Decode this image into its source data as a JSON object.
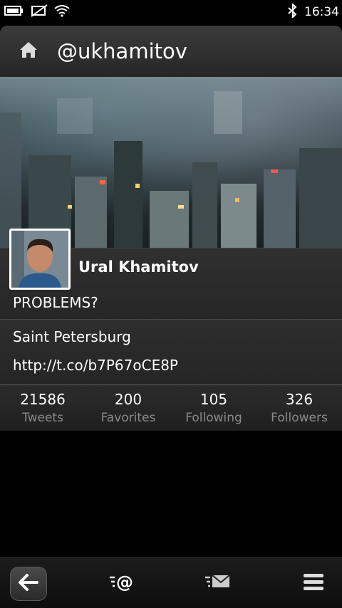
{
  "status_bar": {
    "time": "16:34",
    "icons": [
      "battery-icon",
      "no-sim-icon",
      "wifi-icon",
      "bluetooth-icon"
    ]
  },
  "header": {
    "title": "@ukhamitov",
    "home_icon": "home-icon"
  },
  "profile": {
    "display_name": "Ural Khamitov",
    "bio": "PROBLEMS?",
    "location": "Saint Petersburg",
    "url": "http://t.co/b7P67oCE8P"
  },
  "stats": [
    {
      "value": "21586",
      "label": "Tweets"
    },
    {
      "value": "200",
      "label": "Favorites"
    },
    {
      "value": "105",
      "label": "Following"
    },
    {
      "value": "326",
      "label": "Followers"
    }
  ],
  "toolbar": {
    "back_icon": "back-arrow-icon",
    "mentions_icon": "mentions-icon",
    "messages_icon": "direct-messages-icon",
    "menu_icon": "menu-icon"
  },
  "colors": {
    "background": "#000000",
    "header": "#2f2f2f",
    "stat_label": "#8a8a8a"
  }
}
